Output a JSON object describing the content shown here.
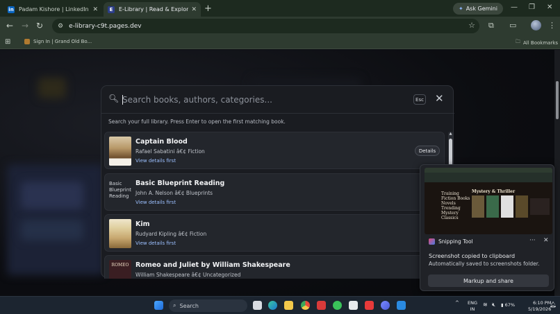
{
  "tabs": [
    {
      "title": "Padam Kishore | LinkedIn",
      "favicon_text": "in",
      "favicon_color": "#0a66c2"
    },
    {
      "title": "E-Library | Read & Explore Books (",
      "favicon_text": "E",
      "favicon_color": "#2c3e8a"
    }
  ],
  "gemini_label": "Ask Gemini",
  "address": "e-library-c9t.pages.dev",
  "bookmark_label": "Sign In | Grand Old Bo...",
  "all_bookmarks": "All Bookmarks",
  "search": {
    "placeholder": "Search books, authors, categories...",
    "esc_label": "Esc",
    "hint": "Search your full library. Press Enter to open the first matching book."
  },
  "results": [
    {
      "title": "Captain Blood",
      "meta": "Rafael Sabatini â€¢ Fiction",
      "link": "View details first",
      "button": "Details"
    },
    {
      "title": "Basic Blueprint Reading",
      "meta": "John A. Nelson â€¢ Blueprints",
      "link": "View details first",
      "cover_alt": "Basic Blueprint Reading"
    },
    {
      "title": "Kim",
      "meta": "Rudyard Kipling â€¢ Fiction",
      "link": "View details first"
    },
    {
      "title": "Romeo and Juliet by William Shakespeare",
      "meta": "William Shakespeare â€¢ Uncategorized",
      "cover_text": "ROMEO"
    }
  ],
  "snip": {
    "app": "Snipping Tool",
    "msg1": "Screenshot copied to clipboard",
    "msg2": "Automatically saved to screenshots folder.",
    "button": "Markup and share",
    "preview_heading": "Mystery & Thriller",
    "preview_list": [
      "Training",
      "Fiction Books",
      "Novels",
      "Trending",
      "Mystery",
      "Classics"
    ]
  },
  "taskbar": {
    "search": "Search",
    "lang_top": "ENG",
    "lang_bottom": "IN",
    "battery": "67%",
    "time": "6:10 PM",
    "date": "5/19/2026"
  }
}
